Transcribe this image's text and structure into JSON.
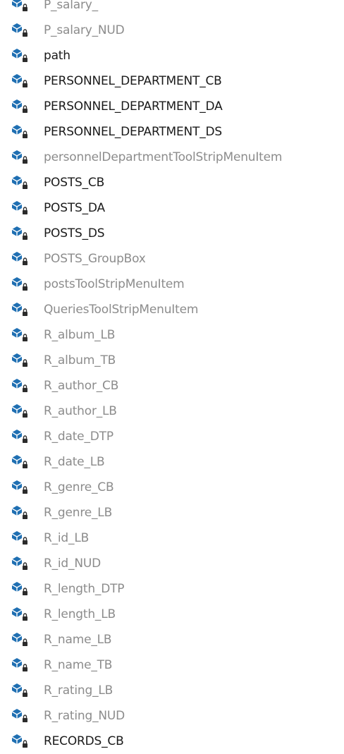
{
  "colors": {
    "public_text": "#1a1a1a",
    "private_text": "#8c8c8c",
    "icon_fill": "#1f6fb2",
    "lock": "#2b2b2b"
  },
  "icon": "field-with-lock-icon",
  "items": [
    {
      "label": "P_salary_",
      "private": true,
      "partial": true
    },
    {
      "label": "P_salary_NUD",
      "private": true
    },
    {
      "label": "path",
      "private": false
    },
    {
      "label": "PERSONNEL_DEPARTMENT_CB",
      "private": false
    },
    {
      "label": "PERSONNEL_DEPARTMENT_DA",
      "private": false
    },
    {
      "label": "PERSONNEL_DEPARTMENT_DS",
      "private": false
    },
    {
      "label": "personnelDepartmentToolStripMenuItem",
      "private": true
    },
    {
      "label": "POSTS_CB",
      "private": false
    },
    {
      "label": "POSTS_DA",
      "private": false
    },
    {
      "label": "POSTS_DS",
      "private": false
    },
    {
      "label": "POSTS_GroupBox",
      "private": true
    },
    {
      "label": "postsToolStripMenuItem",
      "private": true
    },
    {
      "label": "QueriesToolStripMenuItem",
      "private": true
    },
    {
      "label": "R_album_LB",
      "private": true
    },
    {
      "label": "R_album_TB",
      "private": true
    },
    {
      "label": "R_author_CB",
      "private": true
    },
    {
      "label": "R_author_LB",
      "private": true
    },
    {
      "label": "R_date_DTP",
      "private": true
    },
    {
      "label": "R_date_LB",
      "private": true
    },
    {
      "label": "R_genre_CB",
      "private": true
    },
    {
      "label": "R_genre_LB",
      "private": true
    },
    {
      "label": "R_id_LB",
      "private": true
    },
    {
      "label": "R_id_NUD",
      "private": true
    },
    {
      "label": "R_length_DTP",
      "private": true
    },
    {
      "label": "R_length_LB",
      "private": true
    },
    {
      "label": "R_name_LB",
      "private": true
    },
    {
      "label": "R_name_TB",
      "private": true
    },
    {
      "label": "R_rating_LB",
      "private": true
    },
    {
      "label": "R_rating_NUD",
      "private": true
    },
    {
      "label": "RECORDS_CB",
      "private": false
    }
  ]
}
